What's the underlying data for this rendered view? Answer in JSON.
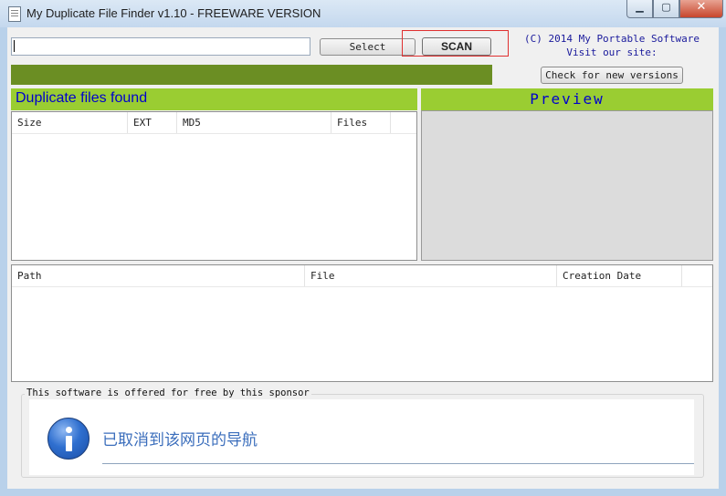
{
  "window": {
    "title": "My Duplicate File Finder v1.10 - FREEWARE VERSION",
    "controls": {
      "minimize": "▁",
      "maximize": "▢",
      "close": "✕"
    }
  },
  "toolbar": {
    "path_value": "",
    "select_label": "Select",
    "scan_label": "SCAN",
    "check_versions_label": "Check for new versions"
  },
  "info": {
    "copyright": "(C) 2014 My Portable Software",
    "visit": "Visit our site:"
  },
  "progress": {
    "fraction": 1.0
  },
  "duplicates": {
    "title": "Duplicate files found",
    "columns": [
      "Size",
      "EXT",
      "MD5",
      "Files"
    ],
    "rows": []
  },
  "preview": {
    "title": "Preview"
  },
  "paths": {
    "columns": [
      "Path",
      "File",
      "Creation Date"
    ],
    "rows": []
  },
  "sponsor": {
    "label": "This software is offered for free by this sponsor",
    "icon": "info-icon",
    "message": "已取消到该网页的导航"
  },
  "colors": {
    "accent_green": "#9acd32",
    "progress_green": "#6b8e23",
    "title_blue": "#0000cc"
  }
}
